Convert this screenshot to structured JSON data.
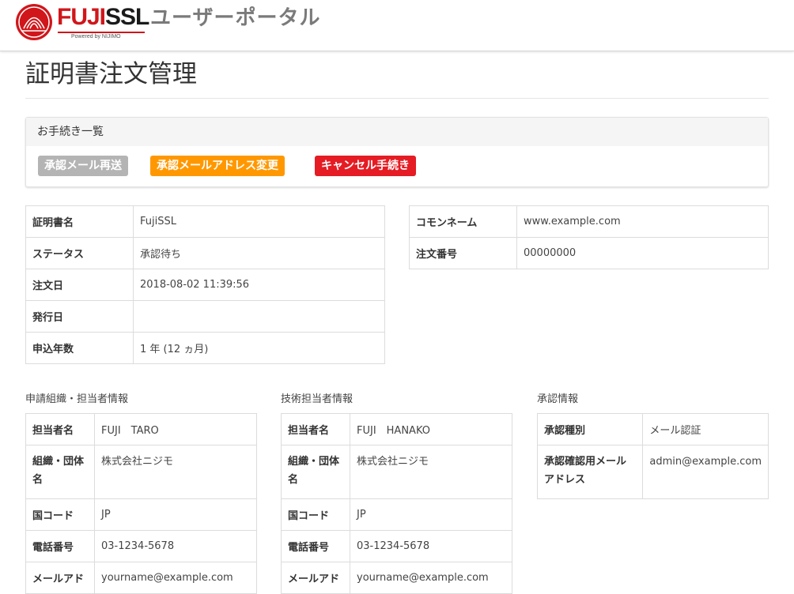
{
  "header": {
    "brand_red": "FUJI",
    "brand_dark": "SSL",
    "powered_by": "Powered by NIJIMO",
    "portal_title": "ユーザーポータル"
  },
  "page": {
    "title": "証明書注文管理"
  },
  "procedures": {
    "title": "お手続き一覧",
    "buttons": {
      "resend": "承認メール再送",
      "change_address": "承認メールアドレス変更",
      "cancel": "キャンセル手続き"
    }
  },
  "certificate": {
    "rows": [
      {
        "label": "証明書名",
        "value": "FujiSSL"
      },
      {
        "label": "ステータス",
        "value": "承認待ち"
      },
      {
        "label": "注文日",
        "value": "2018-08-02 11:39:56"
      },
      {
        "label": "発行日",
        "value": ""
      },
      {
        "label": "申込年数",
        "value": "1 年 (12 ヵ月)"
      }
    ]
  },
  "order": {
    "rows": [
      {
        "label": "コモンネーム",
        "value": "www.example.com"
      },
      {
        "label": "注文番号",
        "value": "00000000"
      }
    ]
  },
  "applicant": {
    "title": "申請組織・担当者情報",
    "rows": [
      {
        "label": "担当者名",
        "value": "FUJI　TARO"
      },
      {
        "label": "組織・団体名",
        "value": "株式会社ニジモ"
      },
      {
        "label": "国コード",
        "value": "JP"
      },
      {
        "label": "電話番号",
        "value": "03-1234-5678"
      },
      {
        "label": "メールアド",
        "value": "yourname@example.com"
      }
    ]
  },
  "technical": {
    "title": "技術担当者情報",
    "rows": [
      {
        "label": "担当者名",
        "value": "FUJI　HANAKO"
      },
      {
        "label": "組織・団体名",
        "value": "株式会社ニジモ"
      },
      {
        "label": "国コード",
        "value": "JP"
      },
      {
        "label": "電話番号",
        "value": "03-1234-5678"
      },
      {
        "label": "メールアド",
        "value": "yourname@example.com"
      }
    ]
  },
  "approval": {
    "title": "承認情報",
    "rows": [
      {
        "label": "承認種別",
        "value": "メール認証"
      },
      {
        "label": "承認確認用メールアドレス",
        "value": "admin@example.com"
      }
    ]
  },
  "colors": {
    "brand_red": "#d0161b",
    "button_gray": "#b4b4b4",
    "button_orange": "#ff9800",
    "button_red": "#e51c23"
  },
  "icons": {
    "logo": "fujissl-logo-icon"
  }
}
